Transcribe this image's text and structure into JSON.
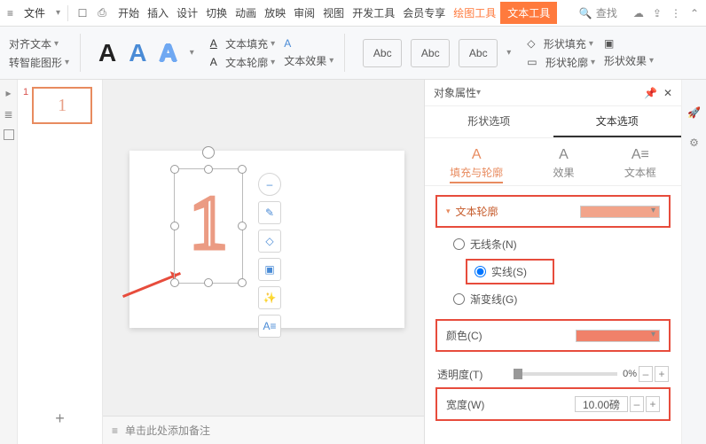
{
  "topbar": {
    "file": "文件",
    "search": "查找"
  },
  "tabs": {
    "start": "开始",
    "insert": "插入",
    "design": "设计",
    "transition": "切换",
    "animation": "动画",
    "show": "放映",
    "review": "审阅",
    "view": "视图",
    "dev": "开发工具",
    "member": "会员专享",
    "draw": "绘图工具",
    "text": "文本工具"
  },
  "ribbon": {
    "align": "对齐文本",
    "smart": "转智能图形",
    "fill": "文本填充",
    "outline": "文本轮廓",
    "effect": "文本效果",
    "abc": "Abc",
    "shapefill": "形状填充",
    "shapeoutline": "形状轮廓",
    "shapeeffect": "形状效果"
  },
  "canvas": {
    "bignum": "1",
    "notes_placeholder": "单击此处添加备注"
  },
  "thumbs": {
    "n1": "1",
    "slide1_text": "1"
  },
  "panel": {
    "title": "对象属性",
    "tab_shape": "形状选项",
    "tab_text": "文本选项",
    "sub_fill": "填充与轮廓",
    "sub_effect": "效果",
    "sub_box": "文本框",
    "section_outline": "文本轮廓",
    "r_none": "无线条(N)",
    "r_solid": "实线(S)",
    "r_grad": "渐变线(G)",
    "color": "颜色(C)",
    "opacity": "透明度(T)",
    "op_val": "0%",
    "width": "宽度(W)",
    "w_val": "10.00磅"
  }
}
